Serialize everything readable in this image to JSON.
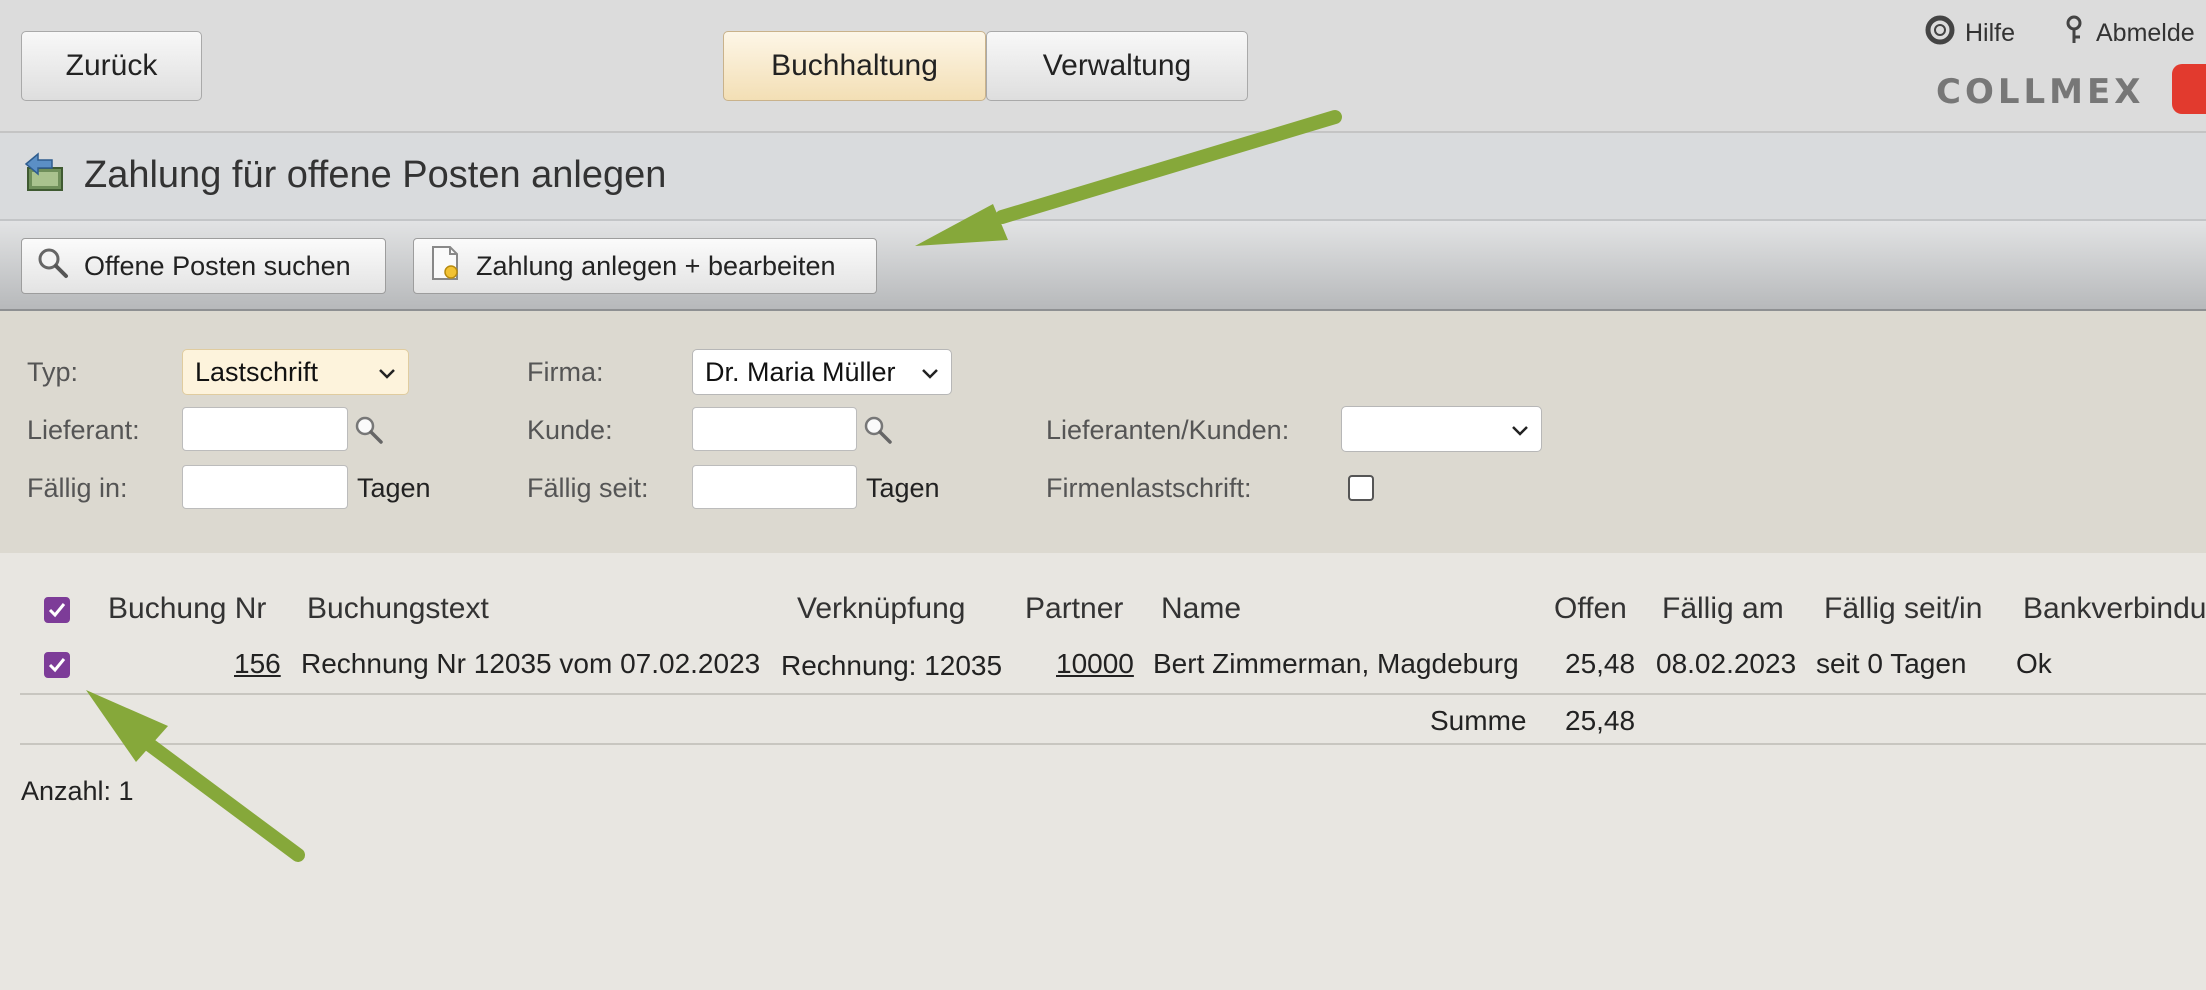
{
  "header": {
    "back_label": "Zurück",
    "tabs": [
      {
        "label": "Buchhaltung",
        "active": true
      },
      {
        "label": "Verwaltung",
        "active": false
      }
    ],
    "help_label": "Hilfe",
    "logout_label": "Abmelde",
    "logo_text": "COLLMEX"
  },
  "page": {
    "title": "Zahlung für offene Posten anlegen"
  },
  "toolbar": {
    "search_label": "Offene Posten suchen",
    "create_label": "Zahlung anlegen + bearbeiten"
  },
  "filters": {
    "typ_label": "Typ:",
    "typ_value": "Lastschrift",
    "firma_label": "Firma:",
    "firma_value": "Dr. Maria Müller",
    "lieferant_label": "Lieferant:",
    "kunde_label": "Kunde:",
    "lief_kunden_label": "Lieferanten/Kunden:",
    "lief_kunden_value": "",
    "faellig_in_label": "Fällig in:",
    "faellig_in_unit": "Tagen",
    "faellig_seit_label": "Fällig seit:",
    "faellig_seit_unit": "Tagen",
    "firmenlastschrift_label": "Firmenlastschrift:",
    "firmenlastschrift_checked": false
  },
  "table": {
    "select_all_checked": true,
    "headers": {
      "buchung_nr": "Buchung Nr",
      "buchungstext": "Buchungstext",
      "verknuepfung": "Verknüpfung",
      "partner": "Partner",
      "name": "Name",
      "offen": "Offen",
      "faellig_am": "Fällig am",
      "faellig_seit": "Fällig seit/in",
      "bank": "Bankverbindu"
    },
    "rows": [
      {
        "checked": true,
        "buchung_nr": "156",
        "buchungstext": "Rechnung Nr 12035 vom 07.02.2023",
        "verknuepfung": "Rechnung: 12035",
        "partner": "10000",
        "name": "Bert Zimmerman, Magdeburg",
        "offen": "25,48",
        "faellig_am": "08.02.2023",
        "faellig_seit": "seit 0 Tagen",
        "bank": "Ok"
      }
    ],
    "sum_label": "Summe",
    "sum_value": "25,48",
    "count_text": "Anzahl: 1"
  },
  "colors": {
    "arrow": "#86a83a",
    "checkbox": "#7d3c98",
    "active_tab": "#f3dfb5"
  }
}
